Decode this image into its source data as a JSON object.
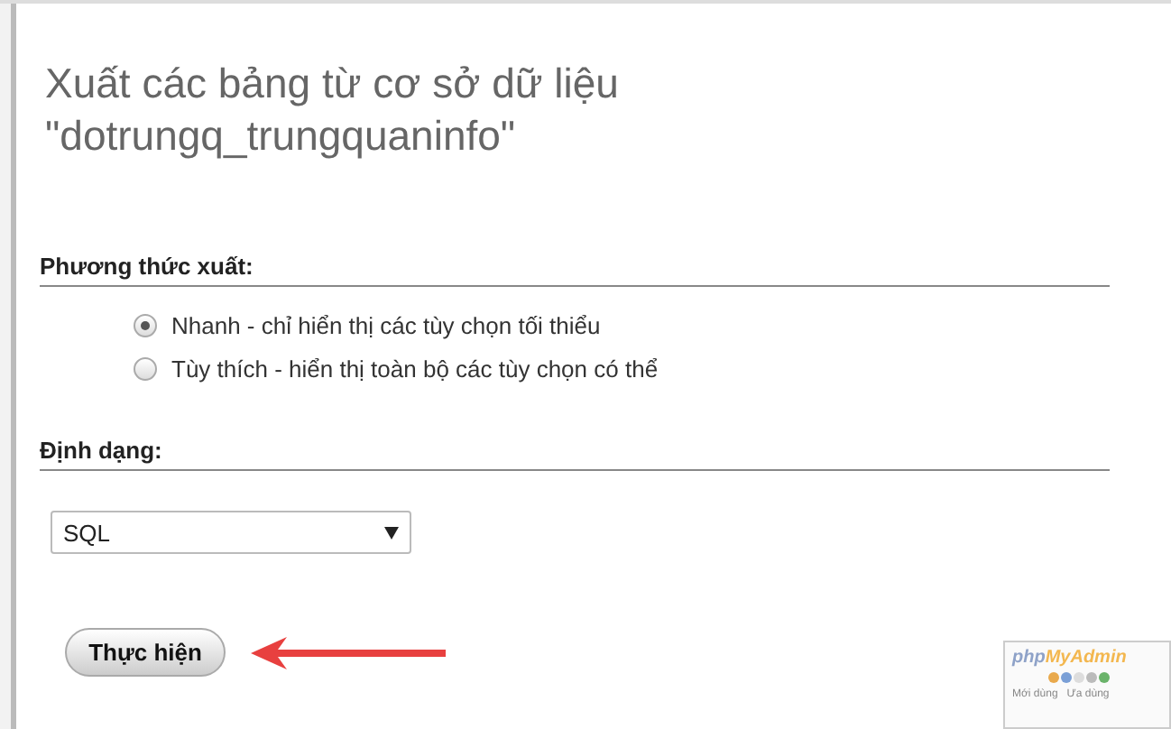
{
  "title": "Xuất các bảng từ cơ sở dữ liệu \"dotrungq_trungquaninfo\"",
  "export_method": {
    "label": "Phương thức xuất:",
    "options": [
      {
        "label": "Nhanh - chỉ hiển thị các tùy chọn tối thiểu",
        "selected": true
      },
      {
        "label": "Tùy thích - hiển thị toàn bộ các tùy chọn có thể",
        "selected": false
      }
    ]
  },
  "format": {
    "label": "Định dạng:",
    "value": "SQL"
  },
  "submit_button": "Thực hiện",
  "inset": {
    "logo": [
      "php",
      "MyAdmin"
    ],
    "links": [
      "Mới dùng",
      "Ưa dùng"
    ]
  }
}
